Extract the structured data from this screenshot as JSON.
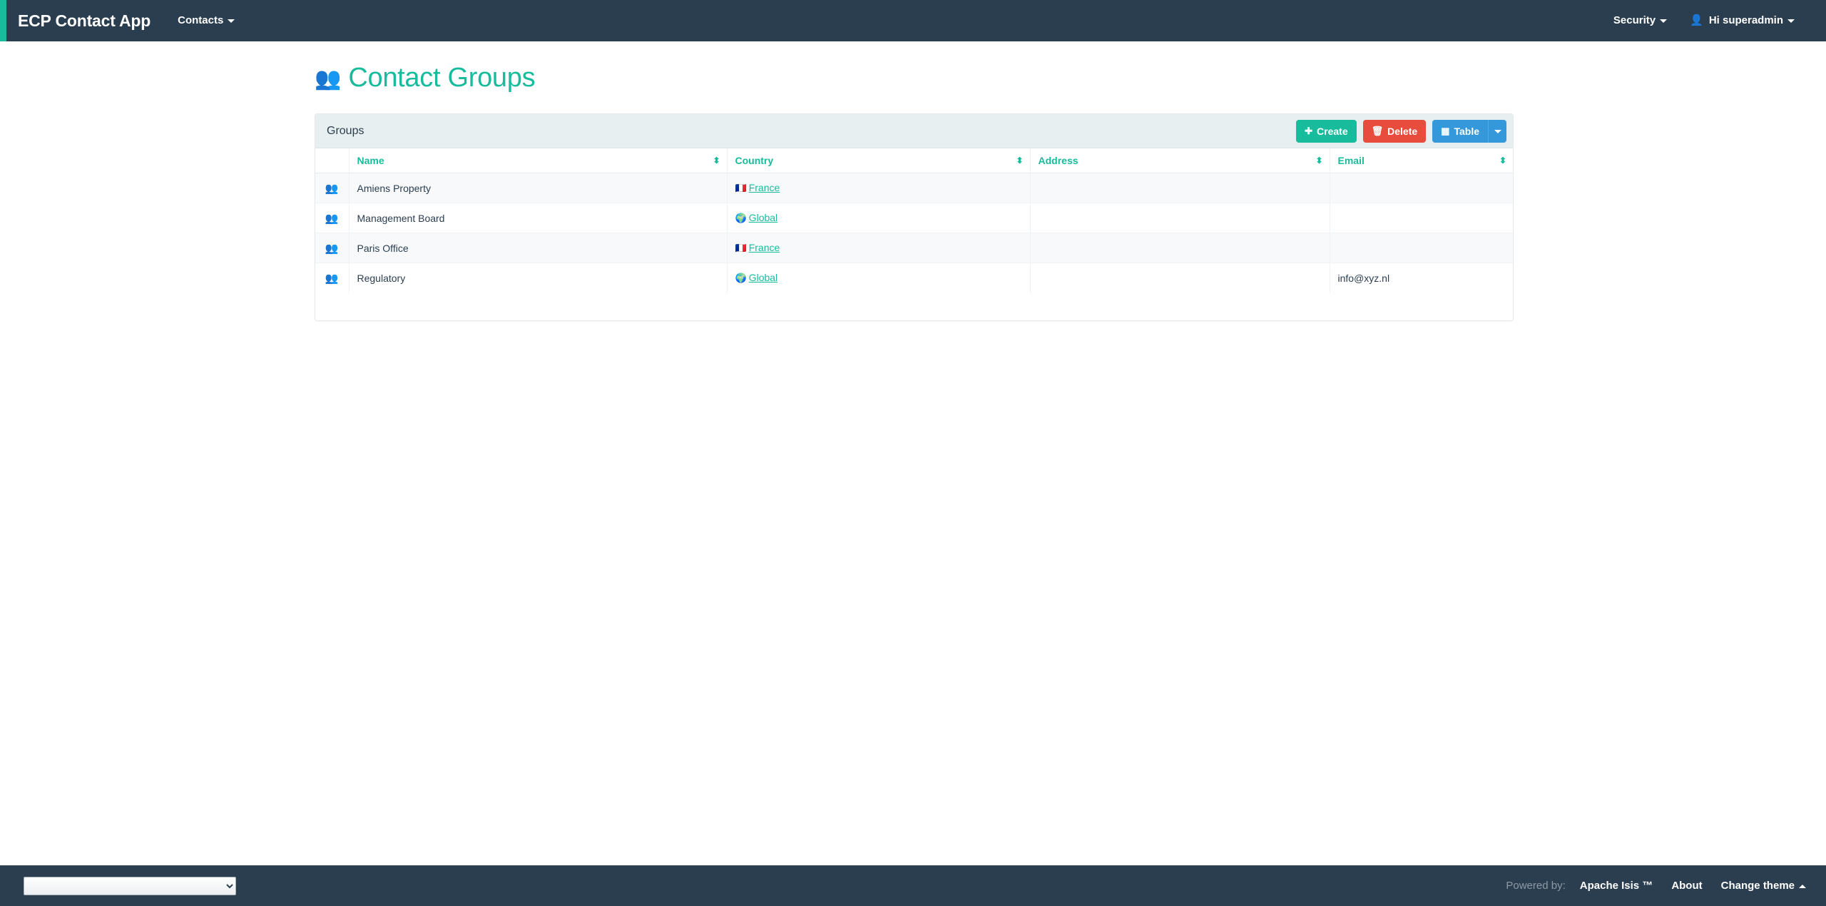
{
  "navbar": {
    "brand": "ECP Contact App",
    "left_items": [
      {
        "label": "Contacts",
        "icon": "chevron-down-icon"
      }
    ],
    "right_items": [
      {
        "label": "Security",
        "icon": "chevron-down-icon"
      },
      {
        "label": "Hi superadmin",
        "icon": "user-icon"
      }
    ],
    "user_glyph": "&#128100;",
    "accent_color": "#18bc9c",
    "background_color": "#2b3e50"
  },
  "page": {
    "title": "Contact Groups",
    "title_icon": "people-icon",
    "title_glyph": "&#128101;",
    "title_color": "#18bc9c"
  },
  "panel": {
    "title": "Groups",
    "buttons": [
      {
        "label": "Create",
        "icon": "plus-icon",
        "glyph": "+",
        "color": "#18bc9c"
      },
      {
        "label": "Delete",
        "icon": "trash-icon",
        "glyph": "🗑",
        "color": "#e74c3c"
      },
      {
        "label": "Table",
        "icon": "table-icon",
        "glyph": "▦",
        "color": "#3498db"
      }
    ],
    "dropdown_caret": "chevron-down-icon"
  },
  "table": {
    "columns": [
      {
        "key": "icon",
        "label": "",
        "sortable": false
      },
      {
        "key": "name",
        "label": "Name",
        "sortable": true
      },
      {
        "key": "country",
        "label": "Country",
        "sortable": true
      },
      {
        "key": "address",
        "label": "Address",
        "sortable": true
      },
      {
        "key": "email",
        "label": "Email",
        "sortable": true
      }
    ],
    "sort_glyph": "⬍",
    "row_icon": "people-icon",
    "row_glyph": "&#128101;",
    "rows": [
      {
        "icon": "people-icon",
        "name": "Amiens Property",
        "country": "France",
        "country_flag": "🇫🇷",
        "address": "",
        "email": ""
      },
      {
        "icon": "people-icon",
        "name": "Management Board",
        "country": "Global",
        "country_flag": "🌍",
        "address": "",
        "email": ""
      },
      {
        "icon": "people-icon",
        "name": "Paris Office",
        "country": "France",
        "country_flag": "🇫🇷",
        "address": "",
        "email": ""
      },
      {
        "icon": "people-icon",
        "name": "Regulatory",
        "country": "Global",
        "country_flag": "🌍",
        "address": "",
        "email": "info@xyz.nl"
      }
    ]
  },
  "footer": {
    "select_value": "",
    "select_options": [
      ""
    ],
    "powered_by_label": "Powered by:",
    "links": [
      {
        "label": "Apache Isis ™"
      },
      {
        "label": "About"
      },
      {
        "label": "Change theme",
        "icon": "chevron-up-icon"
      }
    ]
  }
}
